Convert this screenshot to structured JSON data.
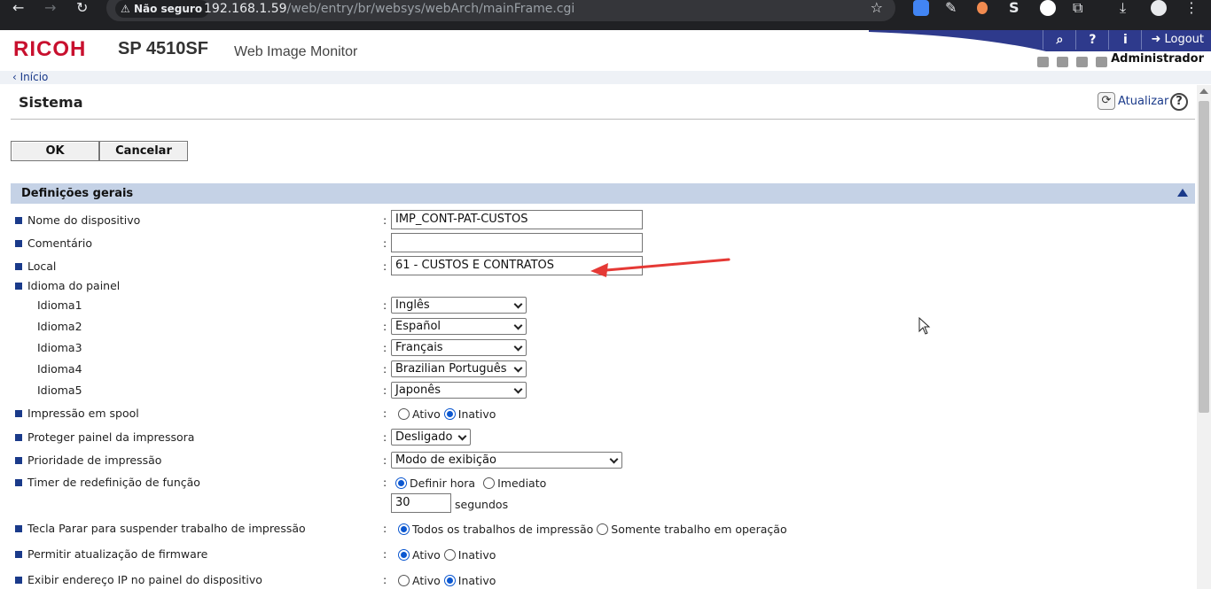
{
  "browser": {
    "security_label": "Não seguro",
    "url_host": "192.168.1.59",
    "url_path": "/web/entry/br/websys/webArch/mainFrame.cgi"
  },
  "header": {
    "logo": "RICOH",
    "model": "SP 4510SF",
    "app_name": "Web Image Monitor",
    "logout_label": "Logout",
    "user": "Administrador",
    "icons": [
      "search-icon",
      "help-icon",
      "info-icon",
      "logout-icon"
    ],
    "brand_color": "#c8102e",
    "accent_color": "#1a3a8a"
  },
  "breadcrumb": {
    "home": "Início"
  },
  "page": {
    "title": "Sistema",
    "refresh_label": "Atualizar",
    "help_symbol": "?"
  },
  "buttons": {
    "ok": "OK",
    "cancel": "Cancelar"
  },
  "section": {
    "title": "Definições gerais"
  },
  "fields": {
    "device_name": {
      "label": "Nome do dispositivo",
      "value": "IMP_CONT-PAT-CUSTOS"
    },
    "comment": {
      "label": "Comentário",
      "value": ""
    },
    "location": {
      "label": "Local",
      "value": "61 - CUSTOS E CONTRATOS"
    },
    "panel_language": {
      "label": "Idioma do painel",
      "items": [
        {
          "label": "Idioma1",
          "value": "Inglês"
        },
        {
          "label": "Idioma2",
          "value": "Español"
        },
        {
          "label": "Idioma3",
          "value": "Français"
        },
        {
          "label": "Idioma4",
          "value": "Brazilian Português"
        },
        {
          "label": "Idioma5",
          "value": "Japonês"
        }
      ]
    },
    "spool": {
      "label": "Impressão em spool",
      "option_a": "Ativo",
      "option_b": "Inativo",
      "selected": "Inativo"
    },
    "protect_panel": {
      "label": "Proteger painel da impressora",
      "value": "Desligado"
    },
    "print_priority": {
      "label": "Prioridade de impressão",
      "value": "Modo de exibição"
    },
    "reset_timer": {
      "label": "Timer de redefinição de função",
      "option_a": "Definir hora",
      "option_b": "Imediato",
      "selected": "Definir hora",
      "seconds": "30",
      "unit": "segundos"
    },
    "stop_key": {
      "label": "Tecla Parar para suspender trabalho de impressão",
      "option_a": "Todos os trabalhos de impressão",
      "option_b": "Somente trabalho em operação",
      "selected": "Todos os trabalhos de impressão"
    },
    "firmware_update": {
      "label": "Permitir atualização de firmware",
      "option_a": "Ativo",
      "option_b": "Inativo",
      "selected": "Ativo"
    },
    "show_ip": {
      "label": "Exibir endereço IP no painel do dispositivo",
      "option_a": "Ativo",
      "option_b": "Inativo",
      "selected": "Inativo"
    }
  },
  "colon": ":"
}
